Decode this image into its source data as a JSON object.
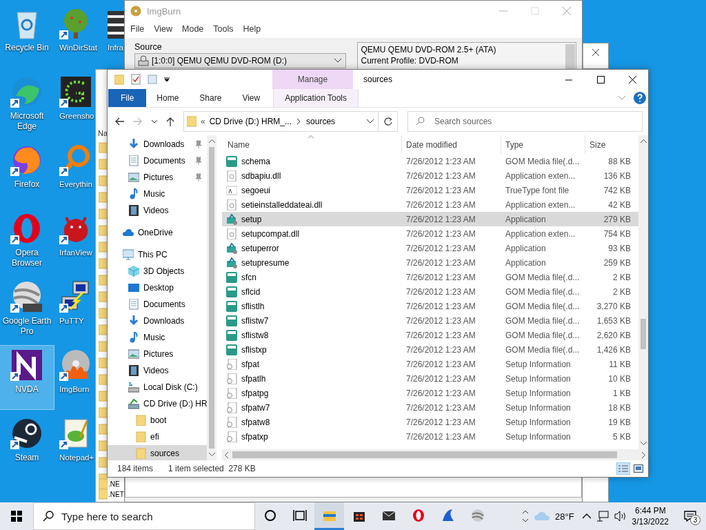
{
  "desktop": {
    "icon_columns": [
      [
        {
          "label": "Recycle Bin",
          "selected": false
        },
        {
          "label": "Microsoft Edge",
          "selected": false
        },
        {
          "label": "Firefox",
          "selected": false
        },
        {
          "label": "Opera Browser",
          "selected": false
        },
        {
          "label": "Google Earth Pro",
          "selected": false
        },
        {
          "label": "NVDA",
          "selected": true
        },
        {
          "label": "Steam",
          "selected": false
        }
      ],
      [
        {
          "label": "WinDirStat",
          "selected": false
        },
        {
          "label": "Greensho",
          "selected": false
        },
        {
          "label": "Everythin",
          "selected": false
        },
        {
          "label": "IrfanView",
          "selected": false
        },
        {
          "label": "PuTTY",
          "selected": false
        },
        {
          "label": "ImgBurn",
          "selected": false
        },
        {
          "label": "Notepad+",
          "selected": false
        }
      ],
      [
        {
          "label": "Infra",
          "selected": false
        }
      ]
    ]
  },
  "back_window": {
    "column_header": "Na",
    "rows": [
      ".NE",
      ".NET"
    ]
  },
  "imgburn": {
    "title": "ImgBurn",
    "menu": [
      "File",
      "View",
      "Mode",
      "Tools",
      "Help"
    ],
    "source_label": "Source",
    "source_value": "[1:0:0] QEMU QEMU DVD-ROM (D:)",
    "info_lines": [
      "QEMU QEMU DVD-ROM 2.5+ (ATA)",
      "Current Profile: DVD-ROM"
    ]
  },
  "explorer": {
    "title": "sources",
    "context_tab": "Manage",
    "ribbon_tabs": [
      {
        "label": "File",
        "selected": false,
        "kind": "file"
      },
      {
        "label": "Home",
        "selected": false,
        "kind": "tab"
      },
      {
        "label": "Share",
        "selected": false,
        "kind": "tab"
      },
      {
        "label": "View",
        "selected": false,
        "kind": "tab"
      },
      {
        "label": "Application Tools",
        "selected": false,
        "kind": "context"
      }
    ],
    "address": {
      "overflow": "«",
      "crumbs": [
        "CD Drive (D:) HRM_...",
        "sources"
      ]
    },
    "search": {
      "placeholder": "Search sources"
    },
    "nav_quick": [
      {
        "label": "Downloads",
        "pinned": true,
        "selected": false
      },
      {
        "label": "Documents",
        "pinned": true,
        "selected": false
      },
      {
        "label": "Pictures",
        "pinned": true,
        "selected": false
      },
      {
        "label": "Music",
        "pinned": false,
        "selected": false
      },
      {
        "label": "Videos",
        "pinned": false,
        "selected": false
      }
    ],
    "nav_tree": [
      {
        "label": "OneDrive",
        "selected": false
      },
      {
        "label": "This PC",
        "selected": false,
        "children": [
          {
            "label": "3D Objects",
            "selected": false
          },
          {
            "label": "Desktop",
            "selected": false
          },
          {
            "label": "Documents",
            "selected": false
          },
          {
            "label": "Downloads",
            "selected": false
          },
          {
            "label": "Music",
            "selected": false
          },
          {
            "label": "Pictures",
            "selected": false
          },
          {
            "label": "Videos",
            "selected": false
          },
          {
            "label": "Local Disk (C:)",
            "selected": false
          },
          {
            "label": "CD Drive (D:) HR",
            "selected": false,
            "children": [
              {
                "label": "boot",
                "selected": false
              },
              {
                "label": "efi",
                "selected": false
              },
              {
                "label": "sources",
                "selected": true
              }
            ]
          }
        ]
      }
    ],
    "columns": [
      "Name",
      "Date modified",
      "Type",
      "Size"
    ],
    "files": [
      {
        "name": "schema",
        "date": "7/26/2012 1:23 AM",
        "type": "GOM Media file(.d...",
        "size": "88 KB",
        "kind": "dat",
        "selected": false
      },
      {
        "name": "sdbapiu.dll",
        "date": "7/26/2012 1:23 AM",
        "type": "Application exten...",
        "size": "136 KB",
        "kind": "dll",
        "selected": false
      },
      {
        "name": "segoeui",
        "date": "7/26/2012 1:23 AM",
        "type": "TrueType font file",
        "size": "742 KB",
        "kind": "font",
        "selected": false
      },
      {
        "name": "setieinstalleddateai.dll",
        "date": "7/26/2012 1:23 AM",
        "type": "Application exten...",
        "size": "42 KB",
        "kind": "dll",
        "selected": false
      },
      {
        "name": "setup",
        "date": "7/26/2012 1:23 AM",
        "type": "Application",
        "size": "279 KB",
        "kind": "app",
        "selected": true
      },
      {
        "name": "setupcompat.dll",
        "date": "7/26/2012 1:23 AM",
        "type": "Application exten...",
        "size": "754 KB",
        "kind": "dll",
        "selected": false
      },
      {
        "name": "setuperror",
        "date": "7/26/2012 1:23 AM",
        "type": "Application",
        "size": "93 KB",
        "kind": "app",
        "selected": false
      },
      {
        "name": "setupresume",
        "date": "7/26/2012 1:23 AM",
        "type": "Application",
        "size": "259 KB",
        "kind": "app",
        "selected": false
      },
      {
        "name": "sfcn",
        "date": "7/26/2012 1:23 AM",
        "type": "GOM Media file(.d...",
        "size": "2 KB",
        "kind": "dat",
        "selected": false
      },
      {
        "name": "sflcid",
        "date": "7/26/2012 1:23 AM",
        "type": "GOM Media file(.d...",
        "size": "2 KB",
        "kind": "dat",
        "selected": false
      },
      {
        "name": "sflistlh",
        "date": "7/26/2012 1:23 AM",
        "type": "GOM Media file(.d...",
        "size": "3,270 KB",
        "kind": "dat",
        "selected": false
      },
      {
        "name": "sflistw7",
        "date": "7/26/2012 1:23 AM",
        "type": "GOM Media file(.d...",
        "size": "1,653 KB",
        "kind": "dat",
        "selected": false
      },
      {
        "name": "sflistw8",
        "date": "7/26/2012 1:23 AM",
        "type": "GOM Media file(.d...",
        "size": "2,620 KB",
        "kind": "dat",
        "selected": false
      },
      {
        "name": "sflistxp",
        "date": "7/26/2012 1:23 AM",
        "type": "GOM Media file(.d...",
        "size": "1,426 KB",
        "kind": "dat",
        "selected": false
      },
      {
        "name": "sfpat",
        "date": "7/26/2012 1:23 AM",
        "type": "Setup Information",
        "size": "11 KB",
        "kind": "inf",
        "selected": false
      },
      {
        "name": "sfpatlh",
        "date": "7/26/2012 1:23 AM",
        "type": "Setup Information",
        "size": "10 KB",
        "kind": "inf",
        "selected": false
      },
      {
        "name": "sfpatpg",
        "date": "7/26/2012 1:23 AM",
        "type": "Setup Information",
        "size": "1 KB",
        "kind": "inf",
        "selected": false
      },
      {
        "name": "sfpatw7",
        "date": "7/26/2012 1:23 AM",
        "type": "Setup Information",
        "size": "18 KB",
        "kind": "inf",
        "selected": false
      },
      {
        "name": "sfpatw8",
        "date": "7/26/2012 1:23 AM",
        "type": "Setup Information",
        "size": "19 KB",
        "kind": "inf",
        "selected": false
      },
      {
        "name": "sfpatxp",
        "date": "7/26/2012 1:23 AM",
        "type": "Setup Information",
        "size": "5 KB",
        "kind": "inf",
        "selected": false
      }
    ],
    "status": {
      "count": "184 items",
      "selection": "1 item selected  278 KB"
    }
  },
  "taskbar": {
    "search_placeholder": "Type here to search",
    "apps": [
      {
        "active": false
      },
      {
        "active": false
      },
      {
        "active": true
      },
      {
        "active": false
      },
      {
        "active": false
      },
      {
        "active": false
      },
      {
        "active": false
      },
      {
        "active": false
      }
    ],
    "weather": "28°F",
    "time": "6:44 PM",
    "date": "3/13/2022",
    "notifications": "3"
  }
}
